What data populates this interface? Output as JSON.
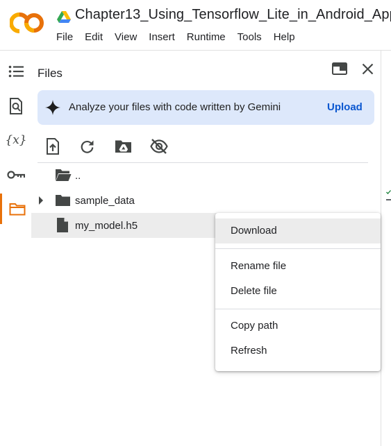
{
  "header": {
    "doc_title": "Chapter13_Using_Tensorflow_Lite_in_Android_App",
    "logo": "colab-logo",
    "drive_icon": "google-drive-icon",
    "menu": [
      "File",
      "Edit",
      "View",
      "Insert",
      "Runtime",
      "Tools",
      "Help"
    ]
  },
  "rail": {
    "items": [
      {
        "icon": "table-of-contents-icon"
      },
      {
        "icon": "find-replace-icon"
      },
      {
        "icon": "variables-icon",
        "label": "{x}"
      },
      {
        "icon": "secrets-key-icon"
      },
      {
        "icon": "folder-icon",
        "active": true
      }
    ]
  },
  "files_panel": {
    "title": "Files",
    "gemini": {
      "text": "Analyze your files with code written by Gemini",
      "action": "Upload"
    },
    "toolbar": [
      "upload-icon",
      "refresh-icon",
      "mount-drive-icon",
      "hide-files-icon"
    ],
    "tree": [
      {
        "name": "..",
        "type": "parent-folder"
      },
      {
        "name": "sample_data",
        "type": "folder",
        "collapsed": true
      },
      {
        "name": "my_model.h5",
        "type": "file",
        "selected": true
      }
    ]
  },
  "context_menu": {
    "groups": [
      [
        "Download"
      ],
      [
        "Rename file",
        "Delete file"
      ],
      [
        "Copy path",
        "Refresh"
      ]
    ],
    "items": {
      "download": "Download",
      "rename": "Rename file",
      "delete": "Delete file",
      "copy_path": "Copy path",
      "refresh": "Refresh"
    }
  },
  "colors": {
    "accent_orange": "#e8710a",
    "gemini_bg": "#dde8fb",
    "link_blue": "#0b57d0",
    "selected_row": "#ececec"
  }
}
